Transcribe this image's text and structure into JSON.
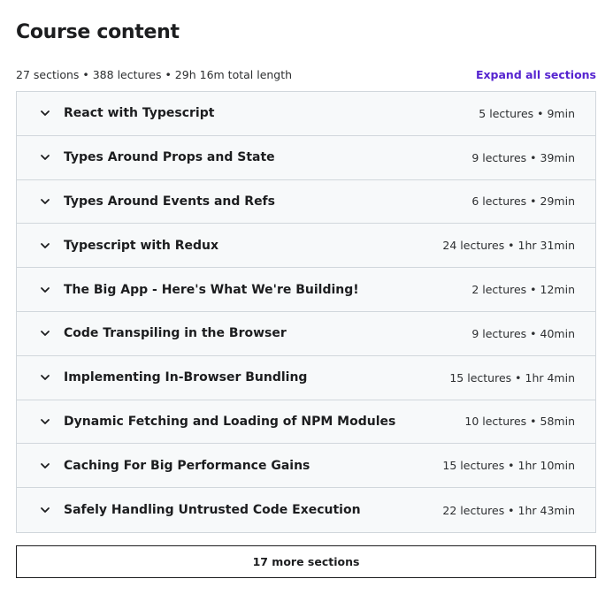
{
  "header": {
    "title": "Course content",
    "summary": "27 sections • 388 lectures • 29h 16m total length",
    "expand_all": "Expand all sections"
  },
  "sections": [
    {
      "title": "React with Typescript",
      "meta": "5 lectures • 9min"
    },
    {
      "title": "Types Around Props and State",
      "meta": "9 lectures • 39min"
    },
    {
      "title": "Types Around Events and Refs",
      "meta": "6 lectures • 29min"
    },
    {
      "title": "Typescript with Redux",
      "meta": "24 lectures • 1hr 31min"
    },
    {
      "title": "The Big App - Here's What We're Building!",
      "meta": "2 lectures • 12min"
    },
    {
      "title": "Code Transpiling in the Browser",
      "meta": "9 lectures • 40min"
    },
    {
      "title": "Implementing In-Browser Bundling",
      "meta": "15 lectures • 1hr 4min"
    },
    {
      "title": "Dynamic Fetching and Loading of NPM Modules",
      "meta": "10 lectures • 58min"
    },
    {
      "title": "Caching For Big Performance Gains",
      "meta": "15 lectures • 1hr 10min"
    },
    {
      "title": "Safely Handling Untrusted Code Execution",
      "meta": "22 lectures • 1hr 43min"
    }
  ],
  "more_button": "17 more sections",
  "icons": {
    "section_toggle": "chevron-down-icon"
  },
  "colors": {
    "accent": "#5624d0",
    "section_bg": "#f7f9fa",
    "border": "#d1d7dc",
    "text": "#1c1d1f"
  }
}
